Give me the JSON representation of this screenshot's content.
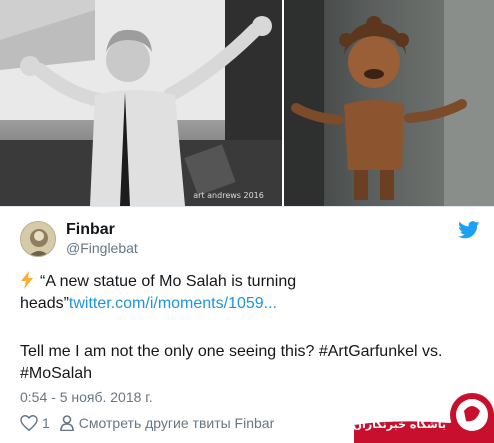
{
  "media": {
    "left_alt_icon": "photo-concert-man",
    "right_alt_icon": "photo-bronze-statue",
    "left_watermark": "art andrews 2016"
  },
  "tweet": {
    "display_name": "Finbar",
    "handle": "@Finglebat",
    "paragraph1_quote": "“A new statue of Mo Salah is turning heads”",
    "paragraph1_link": "twitter.com/i/moments/1059...",
    "paragraph2_text": "Tell me I am not the only one seeing this?",
    "hashtag1": "#ArtGarfunkel",
    "paragraph2_mid": " vs.",
    "hashtag2": "#MoSalah",
    "timestamp": "0:54 - 5 нояб. 2018 г.",
    "like_count": "1",
    "more_tweets_label": "Смотреть другие твиты Finbar"
  },
  "watermark": {
    "site_text": "باشگاه خبرنگاران",
    "logo_color": "#c8102e"
  },
  "colors": {
    "link": "#1b95e0",
    "muted": "#657786",
    "text": "#14171a",
    "bolt": "#ffac33"
  }
}
